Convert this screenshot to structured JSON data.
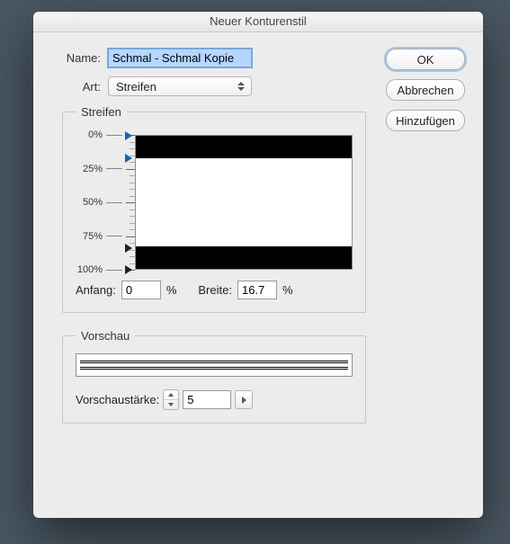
{
  "window": {
    "title": "Neuer Konturenstil"
  },
  "fields": {
    "name_label": "Name:",
    "name_value": "Schmal - Schmal Kopie",
    "type_label": "Art:",
    "type_value": "Streifen"
  },
  "buttons": {
    "ok": "OK",
    "cancel": "Abbrechen",
    "add": "Hinzufügen"
  },
  "stripes": {
    "legend": "Streifen",
    "scale_labels": [
      "0%",
      "25%",
      "50%",
      "75%",
      "100%"
    ],
    "bands": [
      {
        "start_pct": 0.0,
        "width_pct": 16.7
      },
      {
        "start_pct": 83.3,
        "width_pct": 16.7
      }
    ],
    "start_label": "Anfang:",
    "start_value": "0",
    "width_label": "Breite:",
    "width_value": "16.7",
    "pct": "%"
  },
  "preview": {
    "legend": "Vorschau",
    "thickness_label": "Vorschaustärke:",
    "thickness_value": "5"
  }
}
